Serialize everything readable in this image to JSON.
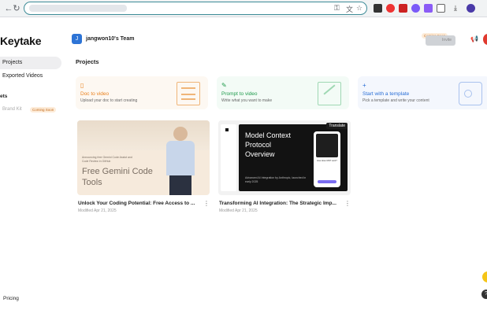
{
  "browser": {
    "icons": [
      "reload-icon",
      "translate-icon",
      "star-icon"
    ]
  },
  "app": {
    "brand": "Keytake",
    "nav": {
      "projects": "Projects",
      "exported_videos": "Exported Videos",
      "section_assets": "ets",
      "brand_kit": "Brand Kit",
      "coming_soon": "Coming Soon",
      "pricing": "Pricing"
    },
    "team": {
      "avatar_initial": "J",
      "name": "jangwon10's Team"
    },
    "header": {
      "upgrade_badge": "Coming Soon",
      "upgrade_label": "Invite"
    },
    "page_title": "Projects"
  },
  "actions": [
    {
      "title": "Doc to video",
      "subtitle": "Upload your doc to start creating",
      "color": "#e9801c",
      "bg": "#fdf8f2"
    },
    {
      "title": "Prompt to video",
      "subtitle": "Write what you want to make",
      "color": "#1e9a4b",
      "bg": "#f3fbf6"
    },
    {
      "title": "Start with a template",
      "subtitle": "Pick a template and write your content",
      "color": "#2a6fd6",
      "bg": "#f4f7fd"
    }
  ],
  "videos": [
    {
      "thumb_title": "Free Gemini Code Tools",
      "thumb_caption": "Announcing free Gemini Code Assist and Code Review in GitHub",
      "title": "Unlock Your Coding Potential: Free Access to ...",
      "date": "Modified Apr 21, 2025"
    },
    {
      "thumb_title": "Model Context Protocol Overview",
      "thumb_sub": "Advanced AI Integration by Anthropic, launched in early 2025",
      "badge": "Translate",
      "phone_title": "How does MCP work?",
      "title": "Transforming AI Integration: The Strategic Imp...",
      "date": "Modified Apr 21, 2025"
    }
  ],
  "colors": {
    "accent_teal": "#3c8b97",
    "team_blue": "#2d74d6",
    "soon_orange": "#c26a1c"
  }
}
